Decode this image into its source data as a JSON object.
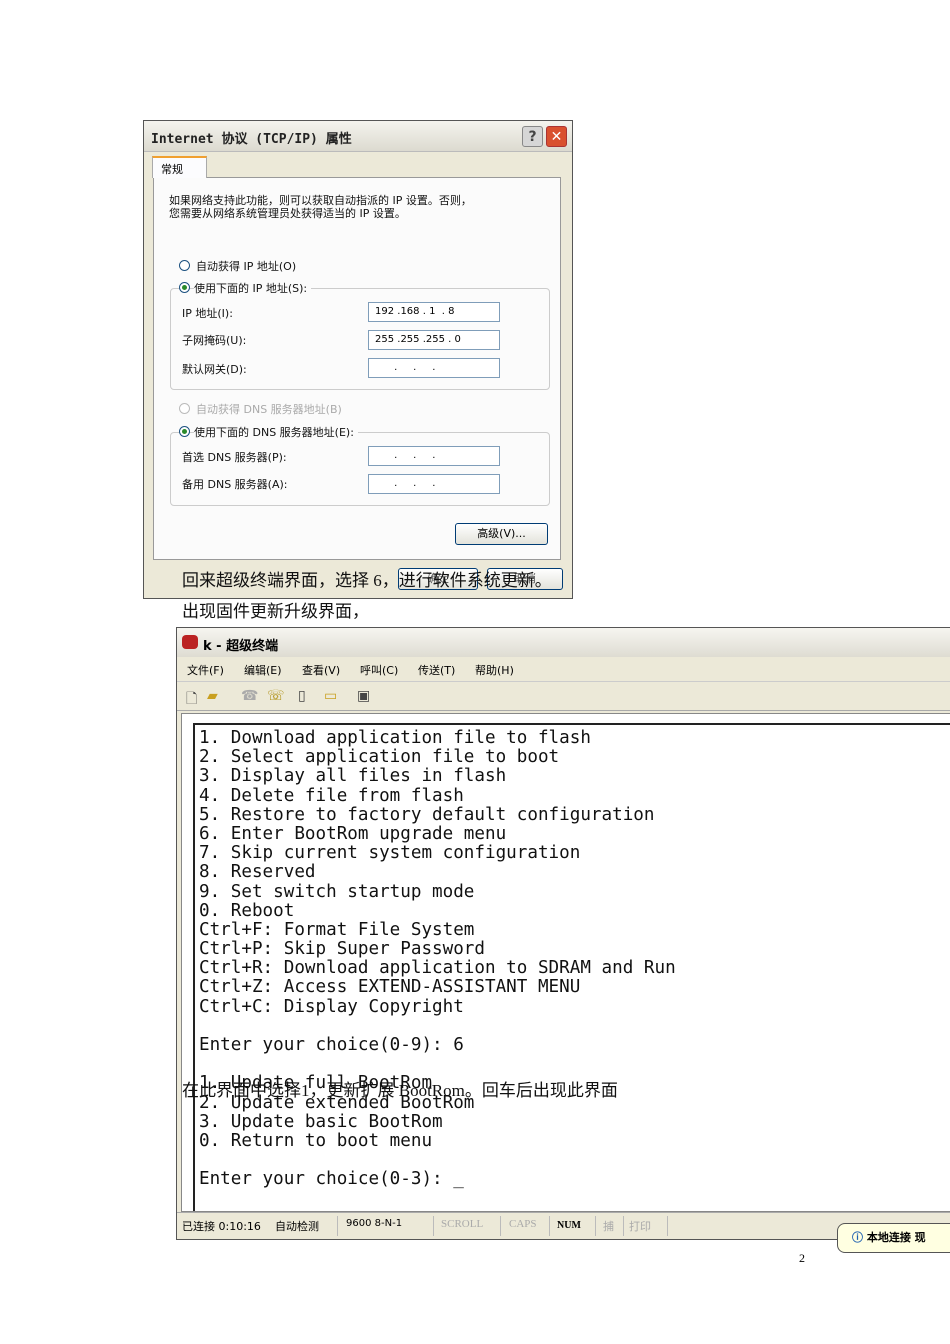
{
  "dialog": {
    "title": "Internet 协议 (TCP/IP) 属性",
    "help_label": "?",
    "close_label": "✕",
    "tab": "常规",
    "desc_line1": "如果网络支持此功能，则可以获取自动指派的 IP 设置。否则，",
    "desc_line2": "您需要从网络系统管理员处获得适当的 IP 设置。",
    "radio_auto_ip": "自动获得 IP 地址(O)",
    "radio_manual_ip": "使用下面的 IP 地址(S):",
    "ip_label": "IP 地址(I):",
    "ip_value": "192 .168 . 1  . 8",
    "mask_label": "子网掩码(U):",
    "mask_value": "255 .255 .255 . 0",
    "gw_label": "默认网关(D):",
    "gw_value": "      .     .     .",
    "radio_auto_dns": "自动获得 DNS 服务器地址(B)",
    "radio_manual_dns": "使用下面的 DNS 服务器地址(E):",
    "dns1_label": "首选 DNS 服务器(P):",
    "dns1_value": "      .     .     .",
    "dns2_label": "备用 DNS 服务器(A):",
    "dns2_value": "      .     .     .",
    "advanced_label": "高级(V)...",
    "ok_label": "确定",
    "cancel_label": "取消"
  },
  "doc": {
    "para1": "回来超级终端界面，选择 6，进行软件系统更新。",
    "para2": "出现固件更新升级界面，",
    "para3": "在此界面中选择1，更新扩展 BootRom。回车后出现此界面",
    "page_number": "2"
  },
  "terminal": {
    "title": "k - 超级终端",
    "menu": [
      "文件(F)",
      "编辑(E)",
      "查看(V)",
      "呼叫(C)",
      "传送(T)",
      "帮助(H)"
    ],
    "toolbar_icons": [
      "new-icon",
      "open-icon",
      "phone-icon",
      "disconnect-icon",
      "send-icon",
      "receive-icon",
      "properties-icon"
    ],
    "lines": [
      "1. Download application file to flash",
      "2. Select application file to boot",
      "3. Display all files in flash",
      "4. Delete file from flash",
      "5. Restore to factory default configuration",
      "6. Enter BootRom upgrade menu",
      "7. Skip current system configuration",
      "8. Reserved",
      "9. Set switch startup mode",
      "0. Reboot",
      "Ctrl+F: Format File System",
      "Ctrl+P: Skip Super Password",
      "Ctrl+R: Download application to SDRAM and Run",
      "Ctrl+Z: Access EXTEND-ASSISTANT MENU",
      "Ctrl+C: Display Copyright",
      "",
      "Enter your choice(0-9): 6",
      "",
      "1. Update full BootRom",
      "2. Update extended BootRom",
      "3. Update basic BootRom",
      "0. Return to boot menu",
      "",
      "Enter your choice(0-3): _"
    ],
    "status": {
      "connected": "已连接 0:10:16",
      "detect": "自动检测",
      "port": "9600 8-N-1",
      "scroll": "SCROLL",
      "caps": "CAPS",
      "num": "NUM",
      "capture": "捕",
      "print": "打印",
      "balloon": "本地连接 现"
    }
  }
}
